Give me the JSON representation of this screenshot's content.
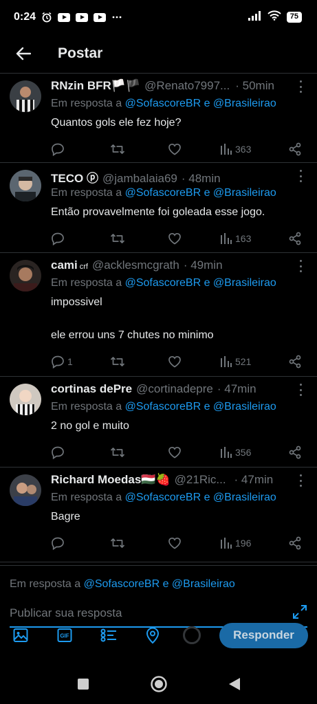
{
  "status_bar": {
    "time": "0:24",
    "icons": [
      "alarm-icon",
      "youtube-icon",
      "youtube-icon",
      "youtube-icon",
      "more-dots-icon"
    ],
    "battery": "75"
  },
  "header": {
    "title": "Postar",
    "back_icon": "arrow-left-icon"
  },
  "replies": [
    {
      "name": "RNzin BFR🏳️🏴",
      "badge": "",
      "handle": "@Renato7997...",
      "time": "· 50min",
      "reply_prefix": "Em resposta a ",
      "mention1": "@SofascoreBR",
      "conj": " e ",
      "mention2": "@Brasileirao",
      "text": [
        "Quantos gols ele fez hoje?"
      ],
      "reply_count": "",
      "views": "363"
    },
    {
      "name": "TECO ⓟ",
      "badge": "",
      "handle": "@jambalaia69",
      "time": "· 48min",
      "reply_prefix": "Em resposta a ",
      "mention1": "@SofascoreBR",
      "conj": " e ",
      "mention2": "@Brasileirao",
      "text": [
        "Então provavelmente foi goleada esse jogo."
      ],
      "reply_count": "",
      "views": "163"
    },
    {
      "name": "cami",
      "badge": "crf",
      "handle": "@acklesmcgrath",
      "time": "· 49min",
      "reply_prefix": "Em resposta a ",
      "mention1": "@SofascoreBR",
      "conj": " e ",
      "mention2": "@Brasileirao",
      "text": [
        "impossivel",
        "ele errou uns 7 chutes no minimo"
      ],
      "reply_count": "1",
      "views": "521"
    },
    {
      "name": "cortinas dePre",
      "badge": "",
      "handle": "@cortinadepre",
      "time": "· 47min",
      "reply_prefix": "Em resposta a ",
      "mention1": "@SofascoreBR",
      "conj": " e ",
      "mention2": "@Brasileirao",
      "text": [
        "2 no gol e muito"
      ],
      "reply_count": "",
      "views": "356"
    },
    {
      "name": "Richard Moedas🇭🇺🍓",
      "badge": "",
      "handle": "@21Ric...",
      "time": "· 47min",
      "reply_prefix": "Em resposta a ",
      "mention1": "@SofascoreBR",
      "conj": " e ",
      "mention2": "@Brasileirao",
      "text": [
        "Bagre"
      ],
      "reply_count": "",
      "views": "196"
    }
  ],
  "composer": {
    "reply_prefix": "Em resposta a ",
    "mention1": "@SofascoreBR",
    "conj": " e ",
    "mention2": "@Brasileirao",
    "placeholder": "Publicar sua resposta",
    "submit_label": "Responder",
    "toolbar_icons": [
      "image-icon",
      "gif-icon",
      "poll-icon",
      "location-icon",
      "char-counter-icon"
    ]
  },
  "nav": {
    "icons": [
      "recents-square-icon",
      "home-circle-icon",
      "back-triangle-icon"
    ]
  },
  "colors": {
    "background": "#000000",
    "text": "#e7e9ea",
    "muted": "#71767b",
    "accent": "#1d9bf0",
    "divider": "#2f3336",
    "button": "#1a6aa6"
  }
}
